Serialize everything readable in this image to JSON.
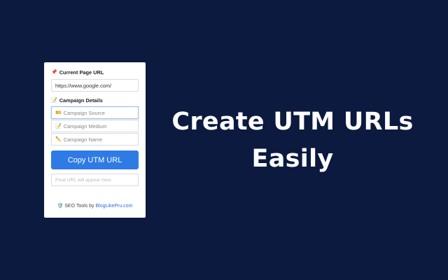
{
  "popup": {
    "current_url": {
      "label_icon": "pin-icon",
      "label": "Current Page URL",
      "value": "https://www.google.com/"
    },
    "campaign": {
      "label_icon": "notes-icon",
      "label": "Campaign Details",
      "fields": [
        {
          "icon": "ticket-icon",
          "icon_glyph": "🎫",
          "placeholder": "Campaign Source"
        },
        {
          "icon": "memo-icon",
          "icon_glyph": "📝",
          "placeholder": "Campaign Medium"
        },
        {
          "icon": "pencil-icon",
          "icon_glyph": "✏️",
          "placeholder": "Campaign Name"
        }
      ]
    },
    "copy_button": "Copy UTM URL",
    "result_placeholder": "Final URL will appear here",
    "footer": {
      "icon": "shield-icon",
      "text": "SEO Tools by",
      "link": "BlogLikePru.com"
    }
  },
  "headline": {
    "line1": "Create UTM URLs",
    "line2": "Easily"
  },
  "colors": {
    "background": "#0b1a3e",
    "button": "#2f7be5",
    "link": "#2a6fd6"
  }
}
